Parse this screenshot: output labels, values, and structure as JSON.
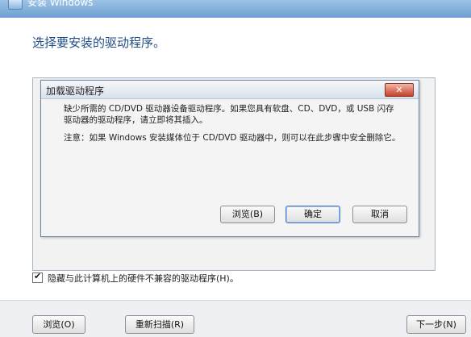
{
  "window": {
    "title": "安装 Windows",
    "heading": "选择要安装的驱动程序。"
  },
  "dialog": {
    "title": "加载驱动程序",
    "close_label": "✕",
    "message_line1": "缺少所需的 CD/DVD 驱动器设备驱动程序。如果您具有软盘、CD、DVD，或 USB 闪存驱动器的驱动程序，请立即将其插入。",
    "message_line2": "注意：如果 Windows 安装媒体位于 CD/DVD 驱动器中，则可以在此步骤中安全删除它。",
    "browse_label": "浏览(B)",
    "ok_label": "确定",
    "cancel_label": "取消"
  },
  "checkbox": {
    "checked": true,
    "label": "隐藏与此计算机上的硬件不兼容的驱动程序(H)。"
  },
  "footer": {
    "browse_label": "浏览(O)",
    "rescan_label": "重新扫描(R)",
    "next_label": "下一步(N)"
  },
  "watermark": "Windows"
}
